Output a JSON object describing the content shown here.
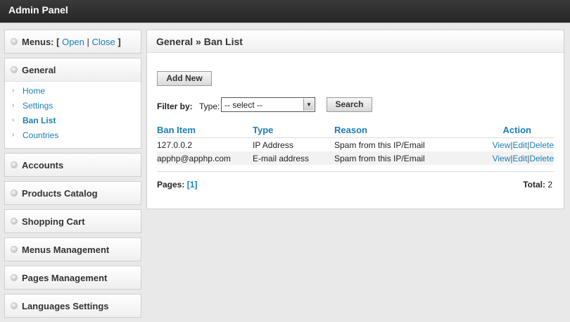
{
  "header": {
    "title": "Admin Panel"
  },
  "sidebar": {
    "menus": {
      "label": "Menus: [",
      "open": "Open",
      "sep": "|",
      "close": "Close",
      "end": "]"
    },
    "general": {
      "title": "General",
      "items": [
        {
          "label": "Home"
        },
        {
          "label": "Settings"
        },
        {
          "label": "Ban List"
        },
        {
          "label": "Countries"
        }
      ]
    },
    "sections": [
      {
        "label": "Accounts"
      },
      {
        "label": "Products Catalog"
      },
      {
        "label": "Shopping Cart"
      },
      {
        "label": "Menus Management"
      },
      {
        "label": "Pages Management"
      },
      {
        "label": "Languages Settings"
      }
    ]
  },
  "main": {
    "heading": "General » Ban List",
    "add_new": "Add New",
    "filter_label": "Filter by:",
    "type_label": "Type:",
    "type_select_value": "-- select --",
    "search_button": "Search",
    "columns": [
      "Ban Item",
      "Type",
      "Reason",
      "Action"
    ],
    "rows": [
      {
        "item": "127.0.0.2",
        "type": "IP Address",
        "reason": "Spam from this IP/Email"
      },
      {
        "item": "apphp@apphp.com",
        "type": "E-mail address",
        "reason": "Spam from this IP/Email"
      }
    ],
    "actions": {
      "view": "View",
      "edit": "Edit",
      "delete": "Delete",
      "sep": "|"
    },
    "pages_label": "Pages:",
    "current_page": "[1]",
    "total_label": "Total:",
    "total_value": "2"
  },
  "colors": {
    "link": "#1a7fb8",
    "topbar": "#2e2e2e",
    "background": "#e9e9e9"
  }
}
